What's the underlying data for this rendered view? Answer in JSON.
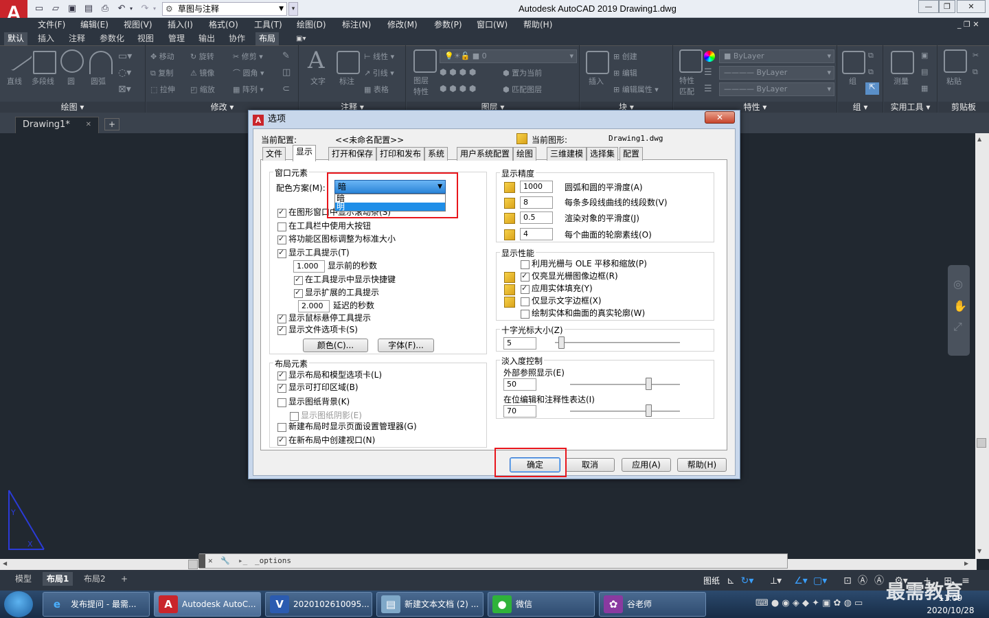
{
  "app": {
    "logo": "A",
    "title": "Autodesk AutoCAD 2019    Drawing1.dwg",
    "workspace": "草图与注释",
    "window_controls": [
      "—",
      "❐",
      "✕"
    ]
  },
  "menubar": [
    "文件(F)",
    "编辑(E)",
    "视图(V)",
    "插入(I)",
    "格式(O)",
    "工具(T)",
    "绘图(D)",
    "标注(N)",
    "修改(M)",
    "参数(P)",
    "窗口(W)",
    "帮助(H)"
  ],
  "ribbon_tabs": [
    "默认",
    "插入",
    "注释",
    "参数化",
    "视图",
    "管理",
    "输出",
    "协作",
    "布局"
  ],
  "ribbon_panels": {
    "draw": {
      "label": "绘图",
      "tools": [
        "直线",
        "多段线",
        "圆",
        "圆弧"
      ]
    },
    "modify": {
      "label": "修改",
      "tools": [
        "移动",
        "旋转",
        "修剪",
        "复制",
        "镜像",
        "圆角",
        "拉伸",
        "缩放",
        "阵列"
      ]
    },
    "annotation": {
      "label": "注释",
      "tools": [
        "文字",
        "标注",
        "线性",
        "引线",
        "表格"
      ]
    },
    "layers": {
      "label": "图层",
      "tools": [
        "图层特性",
        "置为当前",
        "匹配图层"
      ],
      "layer_value": "0"
    },
    "block": {
      "label": "块",
      "tools": [
        "插入",
        "创建",
        "编辑",
        "编辑属性"
      ]
    },
    "properties": {
      "label": "特性",
      "tools": [
        "特性匹配"
      ],
      "color": "ByLayer",
      "linetype": "ByLayer",
      "lineweight": "ByLayer"
    },
    "groups": {
      "label": "组",
      "tools": [
        "组"
      ]
    },
    "utilities": {
      "label": "实用工具",
      "tools": [
        "测量"
      ]
    },
    "clipboard": {
      "label": "剪贴板",
      "tools": [
        "粘贴"
      ]
    }
  },
  "file_tab": {
    "name": "Drawing1*",
    "close": "✕",
    "add": "+"
  },
  "command_line": {
    "text": "_options"
  },
  "layout_tabs": [
    "模型",
    "布局1",
    "布局2"
  ],
  "status": {
    "paper": "图纸",
    "time": "11:09",
    "date": "2020/10/28"
  },
  "taskbar": [
    {
      "label": "发布提问 - 最需...",
      "icon": "e",
      "color": "#2a7ad0"
    },
    {
      "label": "Autodesk AutoC...",
      "icon": "A",
      "color": "#c9252b"
    },
    {
      "label": "2020102610095...",
      "icon": "V",
      "color": "#2b5bb0"
    },
    {
      "label": "新建文本文档 (2) ...",
      "icon": "▤",
      "color": "#7fa8c8"
    },
    {
      "label": "微信",
      "icon": "●",
      "color": "#2fb23a"
    },
    {
      "label": "谷老师",
      "icon": "✿",
      "color": "#8a3aa0"
    }
  ],
  "watermark": "最需教育",
  "dialog": {
    "title": "选项",
    "current_profile_label": "当前配置:",
    "current_profile_value": "<<未命名配置>>",
    "current_drawing_label": "当前图形:",
    "current_drawing_value": "Drawing1.dwg",
    "tabs": [
      "文件",
      "显示",
      "打开和保存",
      "打印和发布",
      "系统",
      "用户系统配置",
      "绘图",
      "三维建模",
      "选择集",
      "配置"
    ],
    "active_tab": "显示",
    "window_elements": {
      "title": "窗口元素",
      "color_scheme_label": "配色方案(M):",
      "color_scheme_value": "暗",
      "color_scheme_options": [
        "暗",
        "明"
      ],
      "show_scrollbars": "在图形窗口中显示滚动条(S)",
      "large_buttons": "在工具栏中使用大按钮",
      "resize_icons": "将功能区图标调整为标准大小",
      "show_tooltips": "显示工具提示(T)",
      "tooltip_delay": "1.000",
      "tooltip_delay_label": "显示前的秒数",
      "show_shortcuts": "在工具提示中显示快捷键",
      "show_extended": "显示扩展的工具提示",
      "extended_delay": "2.000",
      "extended_delay_label": "延迟的秒数",
      "rollover_tips": "显示鼠标悬停工具提示",
      "file_tabs": "显示文件选项卡(S)",
      "colors_btn": "颜色(C)...",
      "fonts_btn": "字体(F)..."
    },
    "layout_elements": {
      "title": "布局元素",
      "layout_model_tabs": "显示布局和模型选项卡(L)",
      "printable_area": "显示可打印区域(B)",
      "paper_background": "显示图纸背景(K)",
      "paper_shadow": "显示图纸阴影(E)",
      "page_setup": "新建布局时显示页面设置管理器(G)",
      "create_viewport": "在新布局中创建视口(N)"
    },
    "display_resolution": {
      "title": "显示精度",
      "rows": [
        {
          "value": "1000",
          "label": "圆弧和圆的平滑度(A)"
        },
        {
          "value": "8",
          "label": "每条多段线曲线的线段数(V)"
        },
        {
          "value": "0.5",
          "label": "渲染对象的平滑度(J)"
        },
        {
          "value": "4",
          "label": "每个曲面的轮廓素线(O)"
        }
      ]
    },
    "display_performance": {
      "title": "显示性能",
      "raster_ole": "利用光栅与 OLE 平移和缩放(P)",
      "highlight_raster": "仅亮显光栅图像边框(R)",
      "solid_fill": "应用实体填充(Y)",
      "text_boundary": "仅显示文字边框(X)",
      "true_silhouettes": "绘制实体和曲面的真实轮廓(W)"
    },
    "crosshair": {
      "title": "十字光标大小(Z)",
      "value": "5",
      "level_percent": 5
    },
    "fade": {
      "title": "淡入度控制",
      "xref_label": "外部参照显示(E)",
      "xref_value": "50",
      "inplace_label": "在位编辑和注释性表达(I)",
      "inplace_value": "70"
    },
    "buttons": {
      "ok": "确定",
      "cancel": "取消",
      "apply": "应用(A)",
      "help": "帮助(H)"
    }
  },
  "colors": {
    "highlight": "#e8151b",
    "selection": "#1e8ee8",
    "accent_logo": "#c9252b"
  }
}
